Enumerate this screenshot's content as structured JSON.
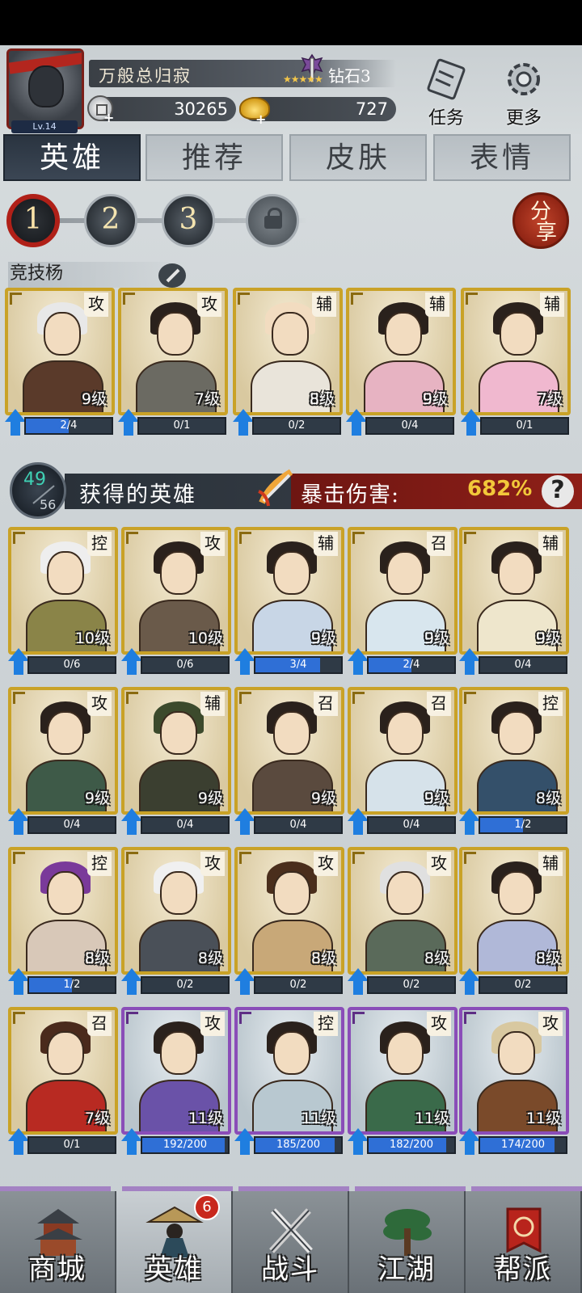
{
  "player": {
    "name": "万般总归寂",
    "level": "Lv.14",
    "rank": "钻石3",
    "rank_stars": 3,
    "coins": "30265",
    "gold": "727"
  },
  "top_buttons": {
    "tasks": "任务",
    "more": "更多"
  },
  "tabs": [
    "英雄",
    "推荐",
    "皮肤",
    "表情"
  ],
  "teams": {
    "numbers": [
      "1",
      "2",
      "3"
    ],
    "share": [
      "分",
      "享"
    ]
  },
  "arena_label": "竞技杨",
  "lineup": [
    {
      "role": "攻",
      "level": "9级",
      "progress": "2/4",
      "fill": 0.5,
      "rarity": "gold",
      "hair": "#e8e8e8",
      "robe": "#5a3a2a"
    },
    {
      "role": "攻",
      "level": "7级",
      "progress": "0/1",
      "fill": 0,
      "rarity": "gold",
      "hair": "#2a211c",
      "robe": "#6b6a62"
    },
    {
      "role": "辅",
      "level": "8级",
      "progress": "0/2",
      "fill": 0,
      "rarity": "gold",
      "hair": "#f2dcc0",
      "robe": "#e9e4da"
    },
    {
      "role": "辅",
      "level": "9级",
      "progress": "0/4",
      "fill": 0,
      "rarity": "gold",
      "hair": "#2a211c",
      "robe": "#e7b3c2"
    },
    {
      "role": "辅",
      "level": "7级",
      "progress": "0/1",
      "fill": 0,
      "rarity": "gold",
      "hair": "#2a211c",
      "robe": "#f0b8cf"
    }
  ],
  "owned": {
    "have": "49",
    "total": "56",
    "title": "获得的英雄",
    "crit_label": "暴击伤害:",
    "crit_value": "682%",
    "help": "?"
  },
  "heroes": [
    {
      "role": "控",
      "level": "10级",
      "progress": "0/6",
      "fill": 0,
      "rarity": "gold",
      "hair": "#eeeeee",
      "robe": "#8a8448"
    },
    {
      "role": "攻",
      "level": "10级",
      "progress": "0/6",
      "fill": 0,
      "rarity": "gold",
      "hair": "#2a211c",
      "robe": "#6a5a4a"
    },
    {
      "role": "辅",
      "level": "9级",
      "progress": "3/4",
      "fill": 0.75,
      "rarity": "gold",
      "hair": "#2a211c",
      "robe": "#c8d6e6"
    },
    {
      "role": "召",
      "level": "9级",
      "progress": "2/4",
      "fill": 0.5,
      "rarity": "gold",
      "hair": "#2a211c",
      "robe": "#d8e6ee"
    },
    {
      "role": "辅",
      "level": "9级",
      "progress": "0/4",
      "fill": 0,
      "rarity": "gold",
      "hair": "#2a211c",
      "robe": "#eee6cc"
    },
    {
      "role": "攻",
      "level": "9级",
      "progress": "0/4",
      "fill": 0,
      "rarity": "gold",
      "hair": "#2a211c",
      "robe": "#3e5a48"
    },
    {
      "role": "辅",
      "level": "9级",
      "progress": "0/4",
      "fill": 0,
      "rarity": "gold",
      "hair": "#3c4a2c",
      "robe": "#3b3f30"
    },
    {
      "role": "召",
      "level": "9级",
      "progress": "0/4",
      "fill": 0,
      "rarity": "gold",
      "hair": "#2a211c",
      "robe": "#5a4a3e"
    },
    {
      "role": "召",
      "level": "9级",
      "progress": "0/4",
      "fill": 0,
      "rarity": "gold",
      "hair": "#2a211c",
      "robe": "#d6e2ea"
    },
    {
      "role": "控",
      "level": "8级",
      "progress": "1/2",
      "fill": 0.5,
      "rarity": "gold",
      "hair": "#2a211c",
      "robe": "#34506a"
    },
    {
      "role": "控",
      "level": "8级",
      "progress": "1/2",
      "fill": 0.5,
      "rarity": "gold",
      "hair": "#7a3a9a",
      "robe": "#d8c8b8"
    },
    {
      "role": "攻",
      "level": "8级",
      "progress": "0/2",
      "fill": 0,
      "rarity": "gold",
      "hair": "#f0f0f0",
      "robe": "#4a5058"
    },
    {
      "role": "攻",
      "level": "8级",
      "progress": "0/2",
      "fill": 0,
      "rarity": "gold",
      "hair": "#4a2e1c",
      "robe": "#c8a878"
    },
    {
      "role": "攻",
      "level": "8级",
      "progress": "0/2",
      "fill": 0,
      "rarity": "gold",
      "hair": "#e0e0e0",
      "robe": "#5a6a5a"
    },
    {
      "role": "辅",
      "level": "8级",
      "progress": "0/2",
      "fill": 0,
      "rarity": "gold",
      "hair": "#2a211c",
      "robe": "#b0b8d8"
    },
    {
      "role": "召",
      "level": "7级",
      "progress": "0/1",
      "fill": 0,
      "rarity": "gold",
      "hair": "#4a2a1c",
      "robe": "#b82a22"
    },
    {
      "role": "攻",
      "level": "11级",
      "progress": "192/200",
      "fill": 0.96,
      "rarity": "purple",
      "hair": "#2a211c",
      "robe": "#6a52a8"
    },
    {
      "role": "控",
      "level": "11级",
      "progress": "185/200",
      "fill": 0.925,
      "rarity": "purple",
      "hair": "#2a211c",
      "robe": "#b8c8d0"
    },
    {
      "role": "攻",
      "level": "11级",
      "progress": "182/200",
      "fill": 0.91,
      "rarity": "purple",
      "hair": "#2a211c",
      "robe": "#3a6a4a"
    },
    {
      "role": "攻",
      "level": "11级",
      "progress": "174/200",
      "fill": 0.87,
      "rarity": "purple",
      "hair": "#d8c8a0",
      "robe": "#7a4a2a"
    }
  ],
  "nav": [
    {
      "label": "商城",
      "active": false
    },
    {
      "label": "英雄",
      "active": true,
      "badge": "6"
    },
    {
      "label": "战斗",
      "active": false
    },
    {
      "label": "江湖",
      "active": false
    },
    {
      "label": "帮派",
      "active": false
    }
  ],
  "colors": {
    "gold_frame": "#c9a227",
    "purple_frame": "#8a4db8",
    "progress_blue": "#2f6fd6",
    "accent_red": "#b02018"
  }
}
